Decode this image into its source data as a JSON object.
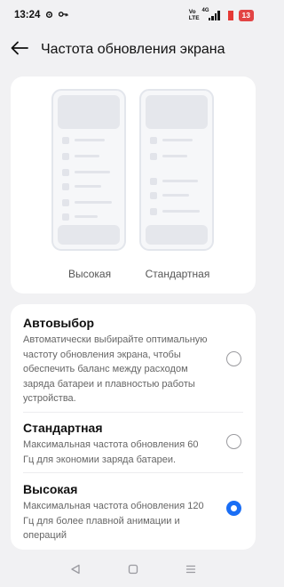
{
  "status_bar": {
    "time": "13:24",
    "volte_top": "Vo",
    "volte_bottom": "LTE",
    "network_label": "4G",
    "battery": "13"
  },
  "header": {
    "title": "Частота обновления экрана"
  },
  "preview": {
    "high_label": "Высокая",
    "standard_label": "Стандартная"
  },
  "options": [
    {
      "title": "Автовыбор",
      "description": "Автоматически выбирайте оптимальную частоту обновления экрана, чтобы обеспечить баланс между расходом заряда батареи и плавностью работы устройства.",
      "selected": false
    },
    {
      "title": "Стандартная",
      "description": "Максимальная частота обновления 60 Гц для экономии заряда батареи.",
      "selected": false
    },
    {
      "title": "Высокая",
      "description": "Максимальная частота обновления 120 Гц для более плавной анимации и операций",
      "selected": true
    }
  ],
  "colors": {
    "accent": "#1a6ef5",
    "background": "#f1f1f3",
    "card": "#ffffff"
  }
}
